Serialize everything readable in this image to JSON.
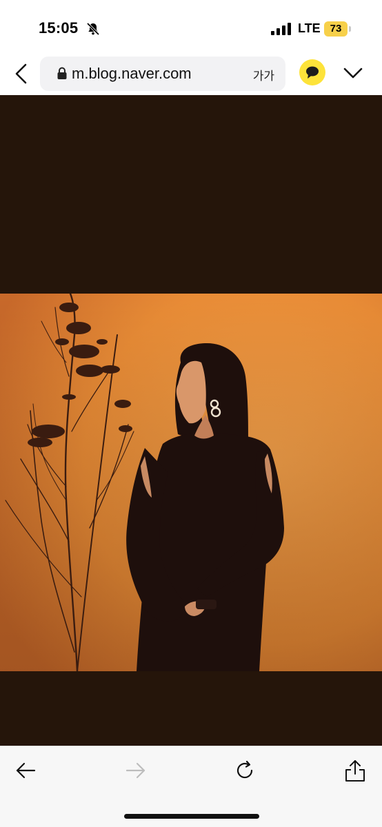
{
  "status_bar": {
    "time": "15:05",
    "network": "LTE",
    "battery_level": "73",
    "icons": [
      "bell-slash-icon",
      "signal-bars-icon",
      "battery-icon"
    ]
  },
  "browser": {
    "url": "m.blog.naver.com",
    "text_size_label": "가가",
    "icons": [
      "chevron-left-icon",
      "lock-icon",
      "chat-bubble-icon",
      "chevron-down-icon"
    ]
  },
  "content": {
    "background_color": "#25150a",
    "photo_colors": {
      "backdrop": "#e9913a",
      "figure": "#1e0f0c"
    }
  },
  "toolbar": {
    "icons": [
      "arrow-left-icon",
      "arrow-right-icon",
      "reload-icon",
      "share-icon"
    ],
    "forward_enabled": false
  },
  "colors": {
    "battery": "#f7d04a",
    "chat_button": "#fde33a"
  }
}
